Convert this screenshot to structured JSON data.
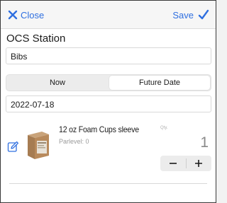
{
  "nav": {
    "close_label": "Close",
    "save_label": "Save",
    "accent": "#2f6fe0"
  },
  "station": {
    "title": "OCS Station",
    "location_value": "Bibs"
  },
  "segment": {
    "options": [
      "Now",
      "Future Date"
    ],
    "selected": "Future Date"
  },
  "date_value": "2022-07-18",
  "product": {
    "name": "12 oz Foam Cups sleeve",
    "qty_caption": "Qty.",
    "parlevel_text": "Parlevel: 0",
    "quantity": "1",
    "icons": {
      "edit": "edit-icon",
      "decrement": "minus-icon",
      "increment": "plus-icon"
    }
  }
}
